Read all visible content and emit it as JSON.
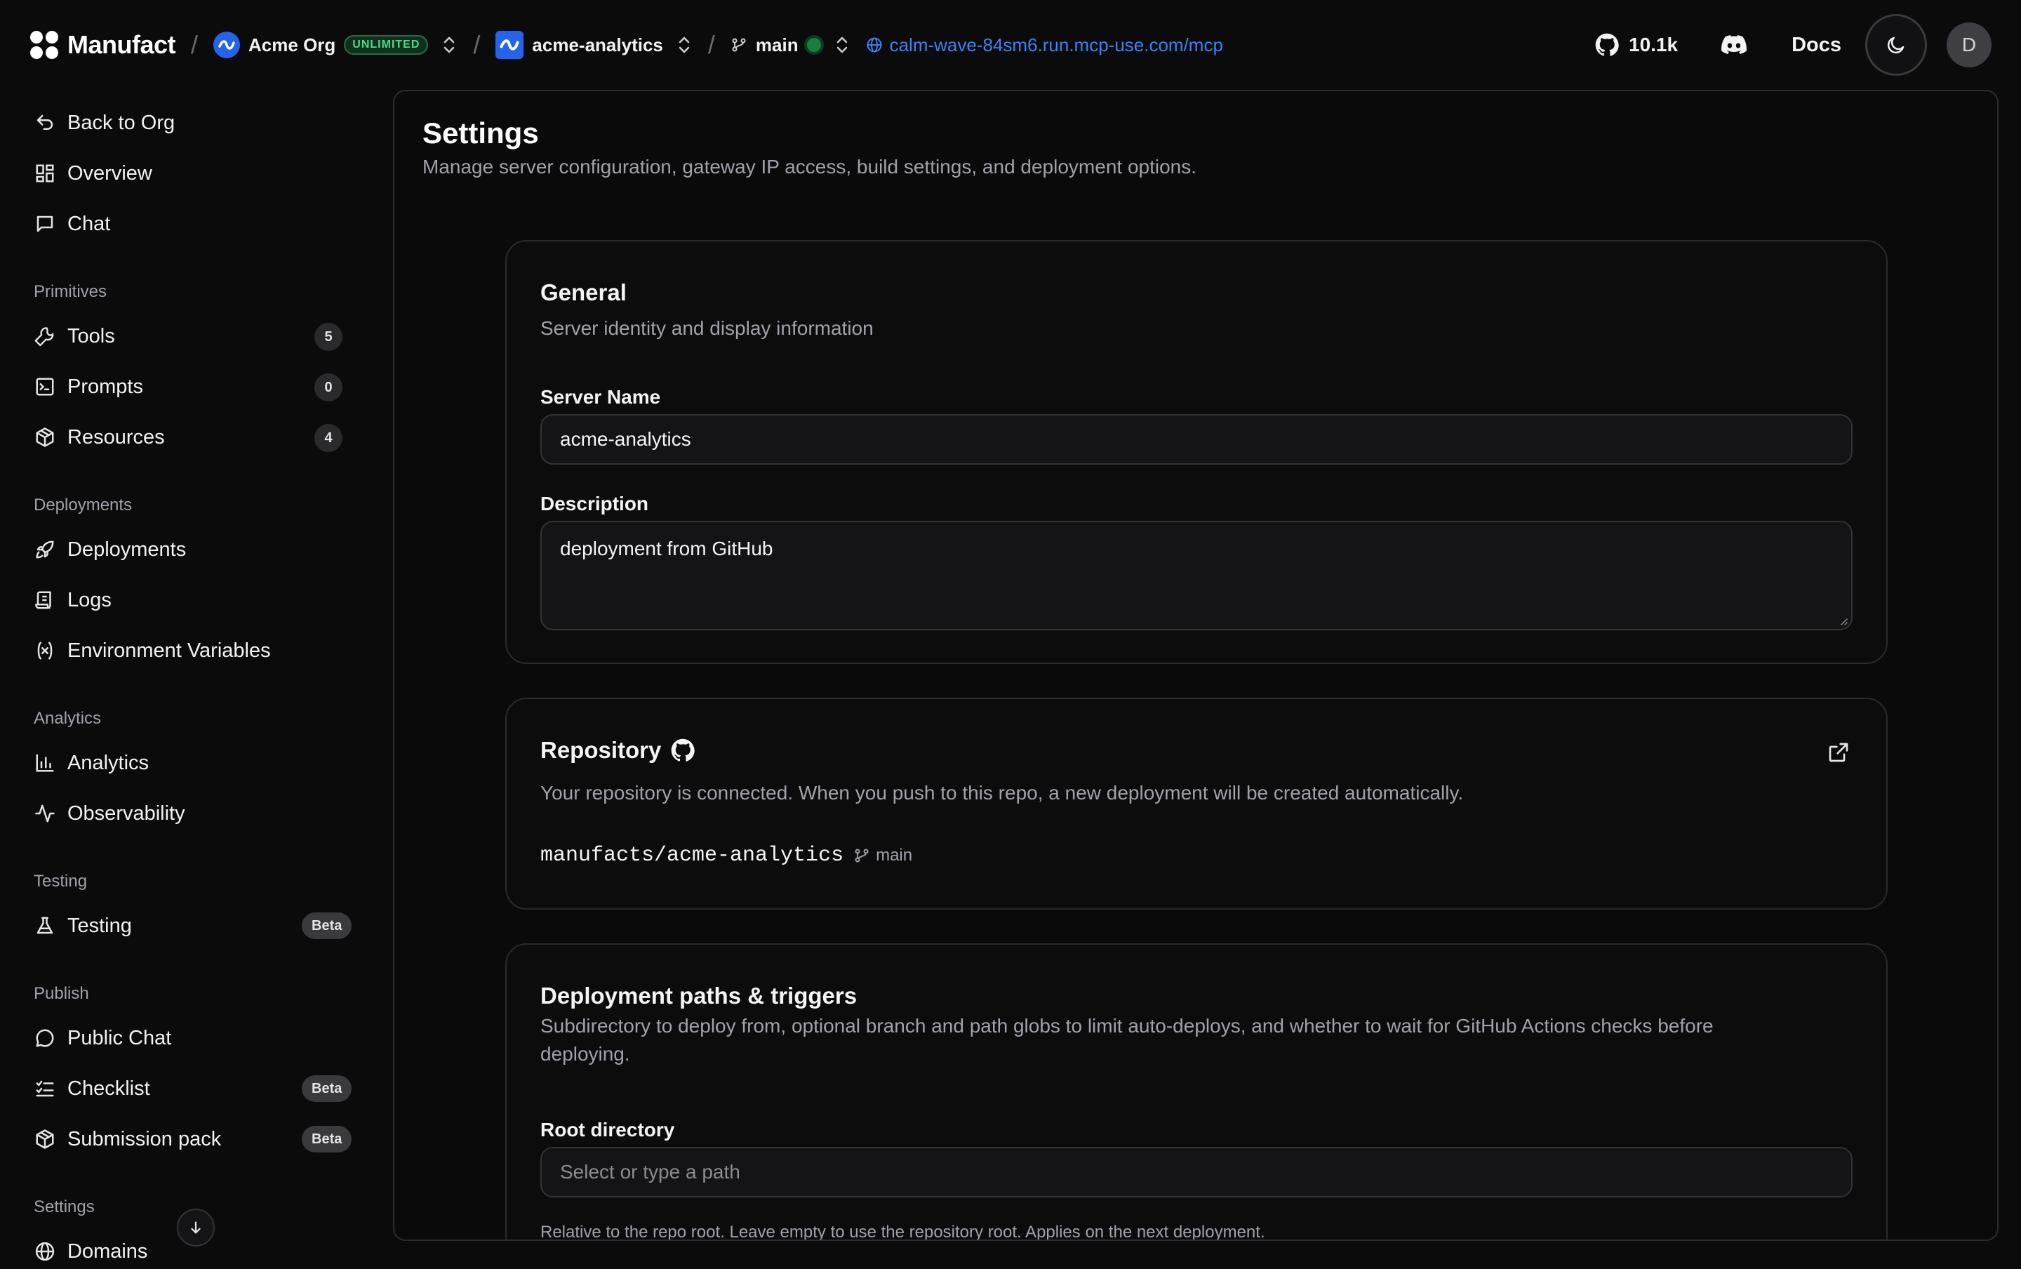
{
  "topbar": {
    "brand": "Manufact",
    "org": {
      "name": "Acme Org",
      "plan": "UNLIMITED"
    },
    "project": {
      "name": "acme-analytics"
    },
    "branch": {
      "name": "main"
    },
    "mcp_url": "calm-wave-84sm6.run.mcp-use.com/mcp",
    "github_stars": "10.1k",
    "docs_label": "Docs",
    "user_initial": "D"
  },
  "sidebar": {
    "back": "Back to Org",
    "overview": "Overview",
    "chat": "Chat",
    "sections": {
      "primitives": "Primitives",
      "deployments": "Deployments",
      "analytics": "Analytics",
      "testing": "Testing",
      "publish": "Publish",
      "settings": "Settings"
    },
    "tools": {
      "label": "Tools",
      "count": "5"
    },
    "prompts": {
      "label": "Prompts",
      "count": "0"
    },
    "resources": {
      "label": "Resources",
      "count": "4"
    },
    "deployments": "Deployments",
    "logs": "Logs",
    "env_vars": "Environment Variables",
    "analytics": "Analytics",
    "observability": "Observability",
    "testing": {
      "label": "Testing",
      "badge": "Beta"
    },
    "public_chat": "Public Chat",
    "checklist": {
      "label": "Checklist",
      "badge": "Beta"
    },
    "submission_pack": {
      "label": "Submission pack",
      "badge": "Beta"
    },
    "domains": "Domains"
  },
  "page": {
    "title": "Settings",
    "subtitle": "Manage server configuration, gateway IP access, build settings, and deployment options."
  },
  "general": {
    "title": "General",
    "desc": "Server identity and display information",
    "server_name_label": "Server Name",
    "server_name_value": "acme-analytics",
    "description_label": "Description",
    "description_value": "deployment from GitHub"
  },
  "repository": {
    "title": "Repository",
    "desc": "Your repository is connected. When you push to this repo, a new deployment will be created automatically.",
    "repo": "manufacts/acme-analytics",
    "branch": "main"
  },
  "deploy_paths": {
    "title": "Deployment paths & triggers",
    "desc": "Subdirectory to deploy from, optional branch and path globs to limit auto-deploys, and whether to wait for GitHub Actions checks before deploying.",
    "root_label": "Root directory",
    "root_placeholder": "Select or type a path",
    "root_help": "Relative to the repo root. Leave empty to use the repository root. Applies on the next deployment."
  }
}
